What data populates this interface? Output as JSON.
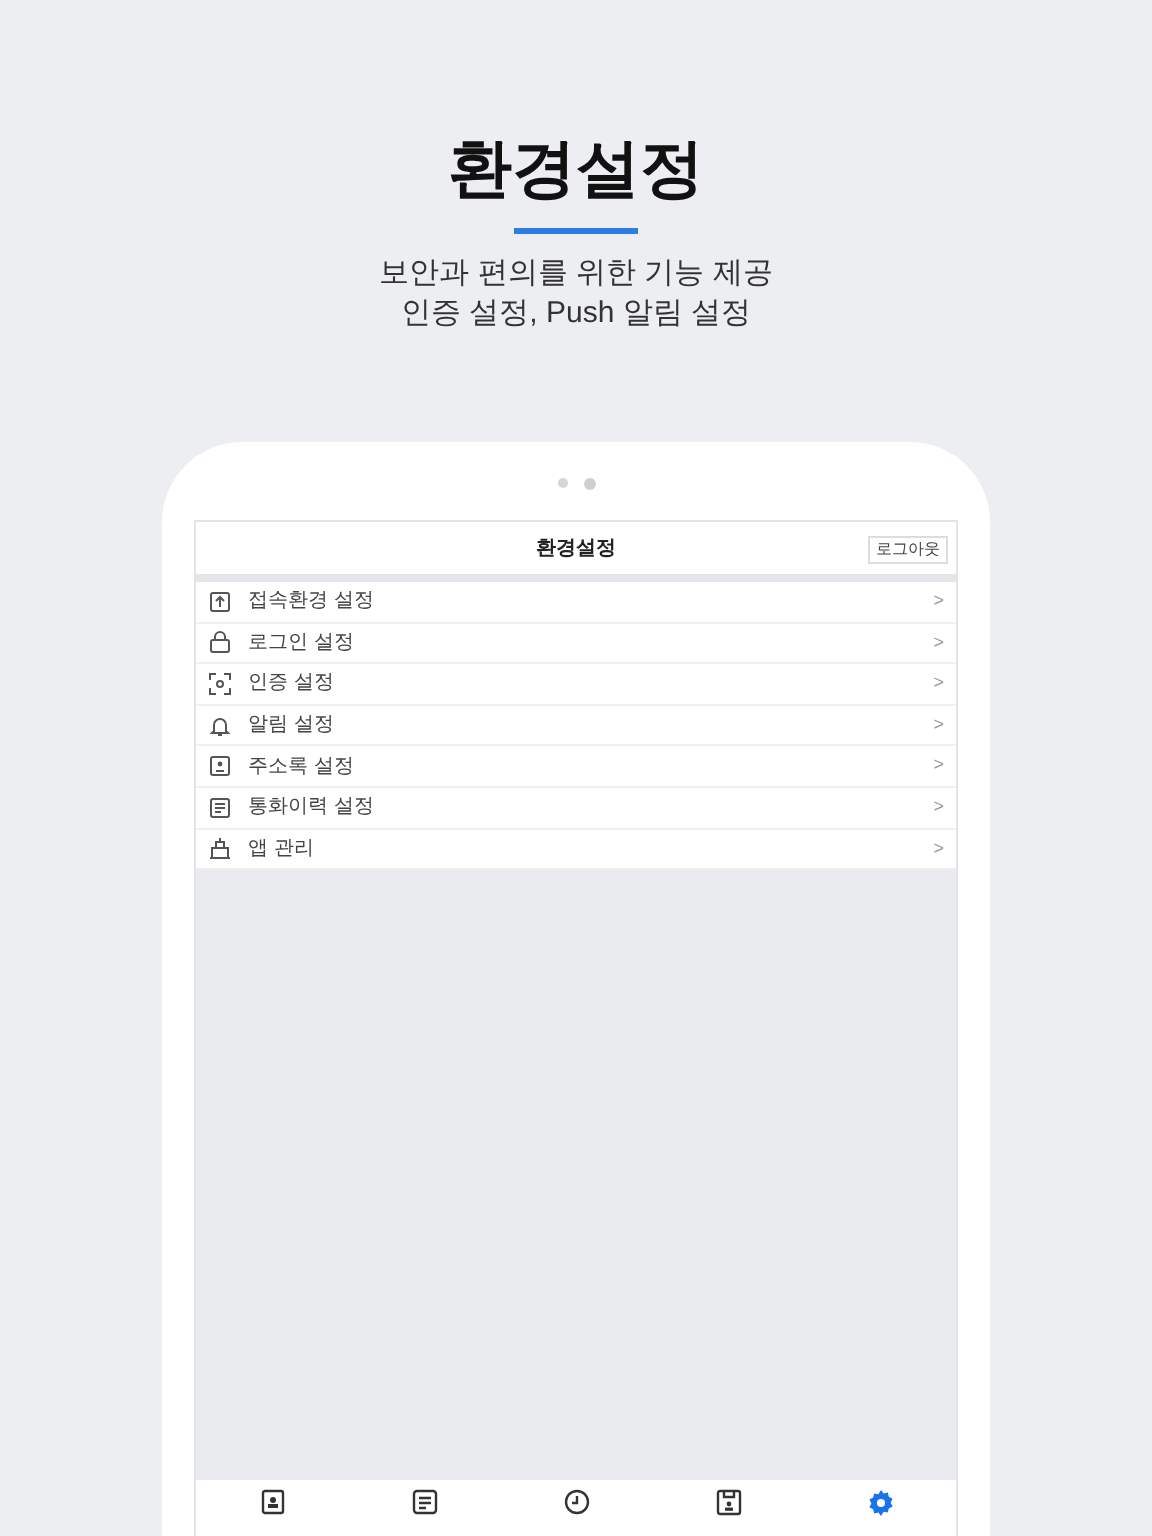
{
  "hero": {
    "title": "환경설정",
    "subtitle": [
      "보안과 편의를 위한 기능 제공",
      "인증 설정, Push 알림 설정"
    ]
  },
  "screen": {
    "title": "환경설정",
    "logout_button": "로그아웃",
    "menu": [
      {
        "label": "접속환경 설정",
        "chevron": ">"
      },
      {
        "label": "로그인 설정",
        "chevron": ">"
      },
      {
        "label": "인증 설정",
        "chevron": ">"
      },
      {
        "label": "알림 설정",
        "chevron": ">"
      },
      {
        "label": "주소록 설정",
        "chevron": ">"
      },
      {
        "label": "통화이력 설정",
        "chevron": ">"
      },
      {
        "label": "앱 관리",
        "chevron": ">"
      }
    ],
    "tabs": [
      {
        "selected": false
      },
      {
        "selected": false
      },
      {
        "selected": false
      },
      {
        "selected": false
      },
      {
        "selected": true
      }
    ]
  }
}
